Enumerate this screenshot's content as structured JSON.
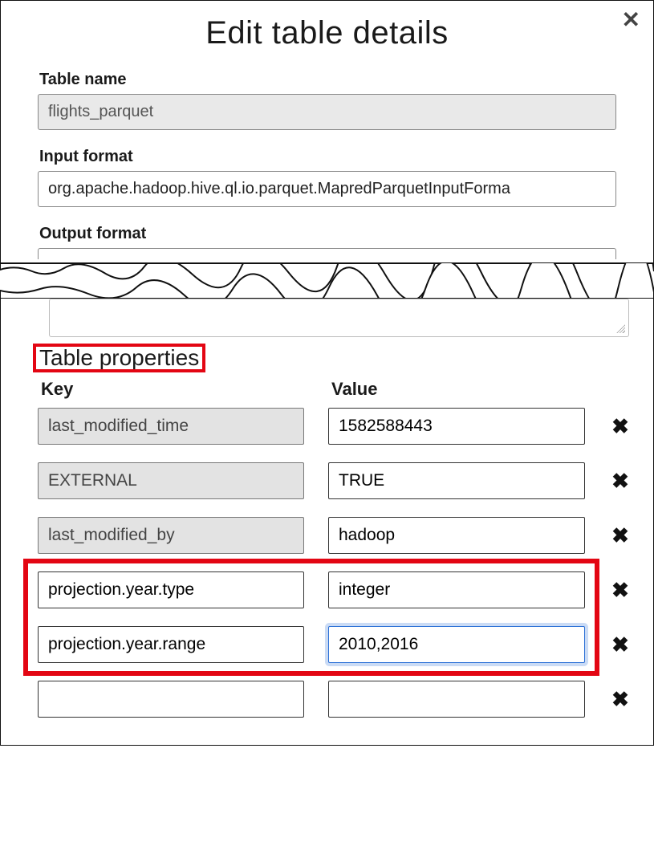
{
  "dialog": {
    "title": "Edit table details",
    "labels": {
      "table_name": "Table name",
      "input_format": "Input format",
      "output_format": "Output format"
    },
    "values": {
      "table_name": "flights_parquet",
      "input_format": "org.apache.hadoop.hive.ql.io.parquet.MapredParquetInputForma"
    }
  },
  "properties": {
    "section_title": "Table properties",
    "headers": {
      "key": "Key",
      "value": "Value"
    },
    "rows": [
      {
        "key": "last_modified_time",
        "value": "1582588443",
        "key_locked": true
      },
      {
        "key": "EXTERNAL",
        "value": "TRUE",
        "key_locked": true
      },
      {
        "key": "last_modified_by",
        "value": "hadoop",
        "key_locked": true
      },
      {
        "key": "projection.year.type",
        "value": "integer",
        "key_locked": false
      },
      {
        "key": "projection.year.range",
        "value": "2010,2016",
        "key_locked": false,
        "value_focused": true
      },
      {
        "key": "",
        "value": "",
        "key_locked": false
      }
    ]
  }
}
